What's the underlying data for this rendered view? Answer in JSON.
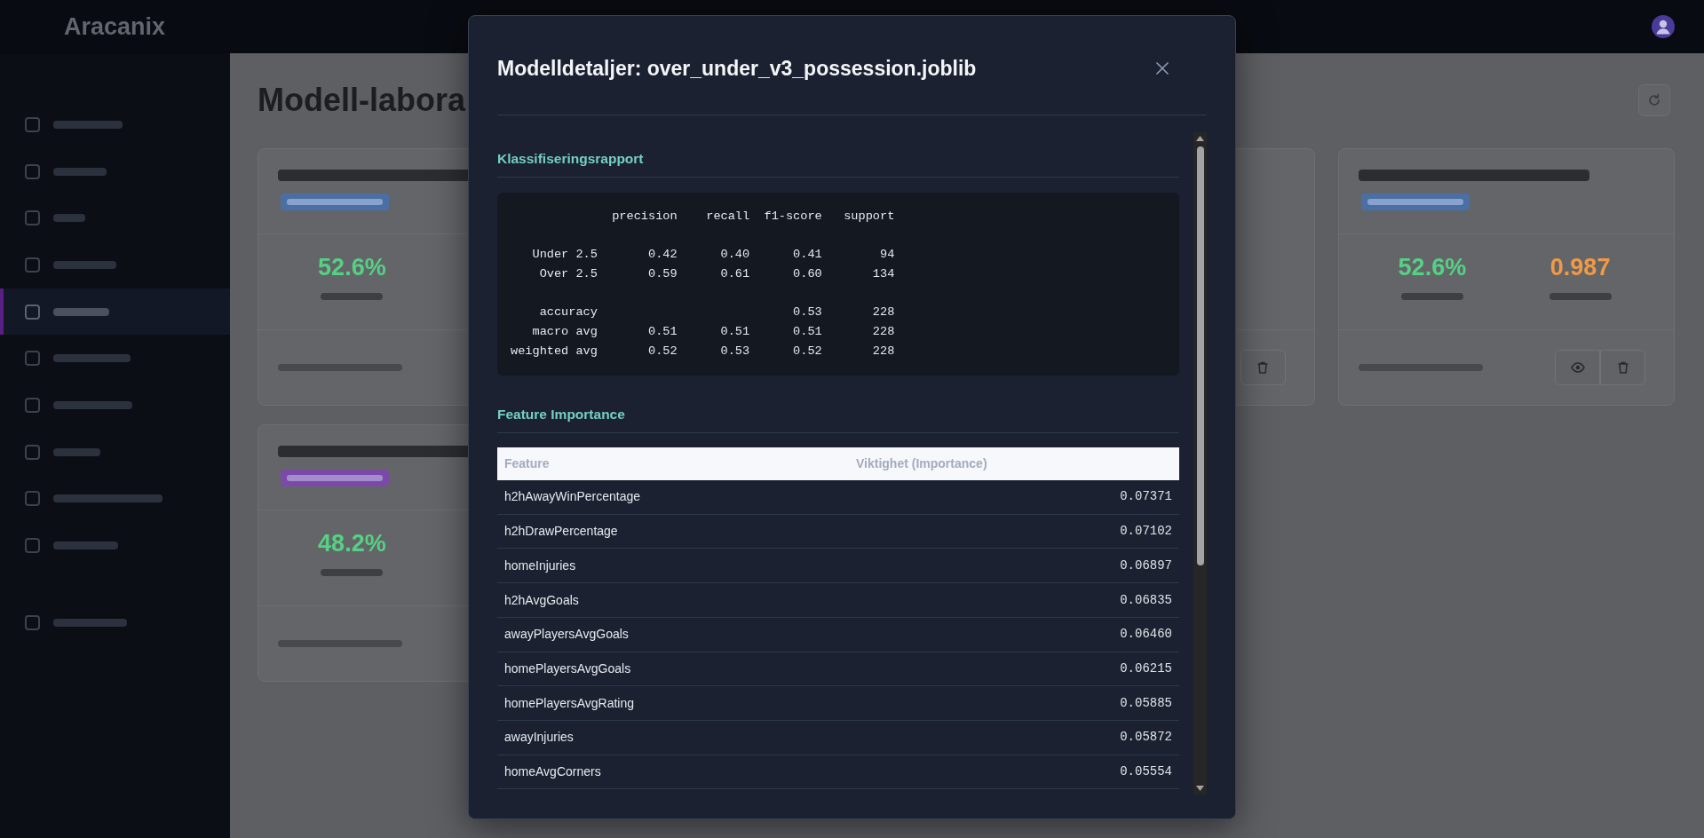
{
  "topbar": {
    "logo": "Aracanix"
  },
  "sidebar": {
    "items": [
      {
        "selected": false
      },
      {
        "selected": false
      },
      {
        "selected": false
      },
      {
        "selected": false
      },
      {
        "selected": true
      },
      {
        "selected": false
      },
      {
        "selected": false
      },
      {
        "selected": false
      },
      {
        "selected": false
      },
      {
        "selected": false
      }
    ],
    "bottom_items": [
      {
        "selected": false
      }
    ]
  },
  "page": {
    "title": "Modell-labora",
    "cards": [
      {
        "title_placeholder": true,
        "badge": {
          "color": "#4a6fa5"
        },
        "metrics": [
          {
            "value": "52.6%",
            "color": "#55d184"
          }
        ],
        "date_placeholder": true
      },
      {
        "actions": [
          {
            "kind": "delete"
          }
        ]
      },
      {
        "title_placeholder": true,
        "badge": {
          "color": "#4a6fa5"
        },
        "metrics": [
          {
            "value": "52.6%",
            "color": "#55d184"
          },
          {
            "value": "0.987",
            "color": "#f09a45"
          }
        ],
        "date_placeholder": true,
        "actions": [
          {
            "kind": "view"
          },
          {
            "kind": "delete"
          }
        ]
      },
      {
        "title_placeholder": true,
        "badge": {
          "color": "#7b4aa8"
        },
        "metrics": [
          {
            "value": "48.2%",
            "color": "#55d184"
          }
        ],
        "date_placeholder": true
      }
    ]
  },
  "modal": {
    "title": "Modelldetaljer: over_under_v3_possession.joblib",
    "sections": [
      {
        "kind": "report",
        "heading": "Klassifiseringsrapport",
        "columns": [
          "precision",
          "recall",
          "f1-score",
          "support"
        ],
        "row_groups": [
          [
            {
              "label": "Under 2.5",
              "precision": "0.42",
              "recall": "0.40",
              "f1_score": "0.41",
              "support": "94"
            },
            {
              "label": "Over 2.5",
              "precision": "0.59",
              "recall": "0.61",
              "f1_score": "0.60",
              "support": "134"
            }
          ],
          [
            {
              "label": "accuracy",
              "f1_score": "0.53",
              "support": "228"
            },
            {
              "label": "macro avg",
              "precision": "0.51",
              "recall": "0.51",
              "f1_score": "0.51",
              "support": "228"
            },
            {
              "label": "weighted avg",
              "precision": "0.52",
              "recall": "0.53",
              "f1_score": "0.52",
              "support": "228"
            }
          ]
        ]
      },
      {
        "kind": "table",
        "heading": "Feature Importance",
        "columns": [
          "Feature",
          "Viktighet (Importance)"
        ],
        "rows": [
          [
            "h2hAwayWinPercentage",
            "0.07371"
          ],
          [
            "h2hDrawPercentage",
            "0.07102"
          ],
          [
            "homeInjuries",
            "0.06897"
          ],
          [
            "h2hAvgGoals",
            "0.06835"
          ],
          [
            "awayPlayersAvgGoals",
            "0.06460"
          ],
          [
            "homePlayersAvgGoals",
            "0.06215"
          ],
          [
            "homePlayersAvgRating",
            "0.05885"
          ],
          [
            "awayInjuries",
            "0.05872"
          ],
          [
            "homeAvgCorners",
            "0.05554"
          ]
        ]
      }
    ]
  }
}
